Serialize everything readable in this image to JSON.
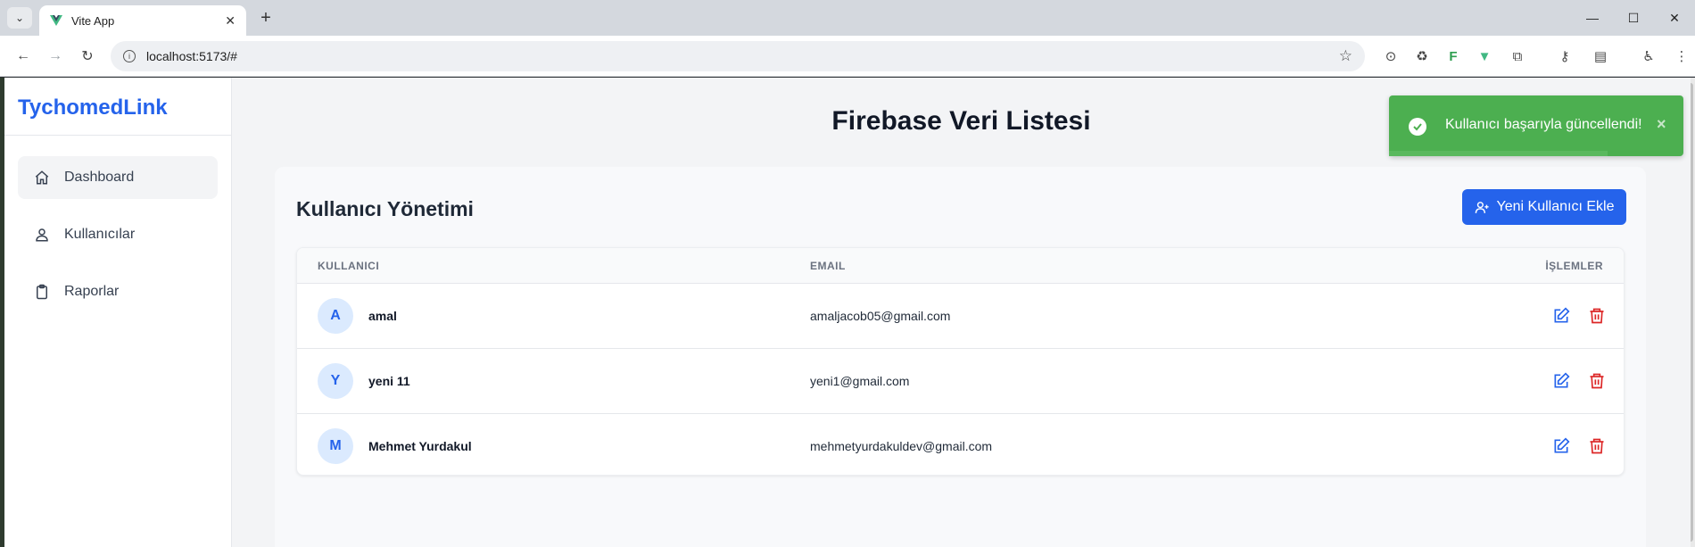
{
  "browser": {
    "tab_title": "Vite App",
    "url": "localhost:5173/#"
  },
  "app": {
    "brand": "TychomedLink",
    "sidebar": {
      "items": [
        {
          "label": "Dashboard",
          "icon": "home-icon",
          "active": true
        },
        {
          "label": "Kullanıcılar",
          "icon": "users-icon",
          "active": false
        },
        {
          "label": "Raporlar",
          "icon": "clipboard-icon",
          "active": false
        }
      ]
    },
    "page_title": "Firebase Veri Listesi",
    "panel_title": "Kullanıcı Yönetimi",
    "add_button_label": "Yeni Kullanıcı Ekle",
    "table": {
      "headers": {
        "user": "KULLANICI",
        "email": "EMAIL",
        "actions": "İŞLEMLER"
      },
      "rows": [
        {
          "initial": "A",
          "name": "amal",
          "email": "amaljacob05@gmail.com"
        },
        {
          "initial": "Y",
          "name": "yeni 11",
          "email": "yeni1@gmail.com"
        },
        {
          "initial": "M",
          "name": "Mehmet Yurdakul",
          "email": "mehmetyurdakuldev@gmail.com"
        }
      ]
    },
    "toast": {
      "message": "Kullanıcı başarıyla güncellendi!",
      "close": "×",
      "color": "#4caf50"
    }
  },
  "colors": {
    "accent": "#2563eb",
    "danger": "#dc2626",
    "success": "#4caf50"
  }
}
